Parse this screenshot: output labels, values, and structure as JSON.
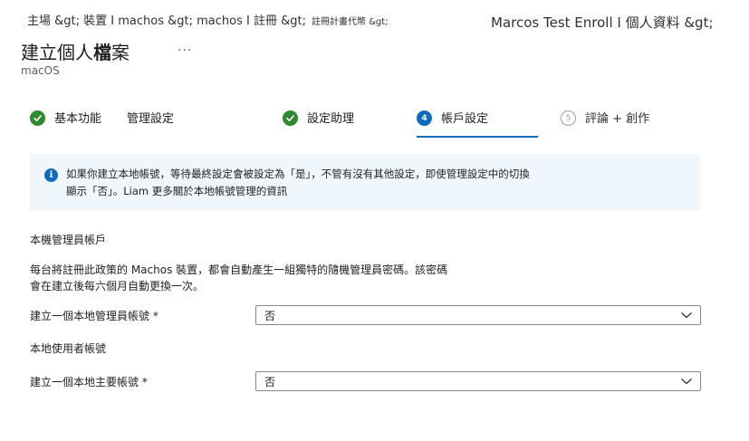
{
  "breadcrumb": {
    "left": "主場 &gt; 裝置 I machos &gt; machos I 註冊 &gt;",
    "small": "註冊計畫代幣 &gt;",
    "right": "Marcos Test Enroll I 個人資料 &gt;"
  },
  "page": {
    "title_a": "建立個人",
    "title_b": "檔",
    "title_c": "案",
    "more": "...",
    "subtitle": "macOS"
  },
  "steps": [
    {
      "number": "1",
      "label": "基本功能",
      "state": "done"
    },
    {
      "number": "2",
      "label": "管理設定",
      "state": "done"
    },
    {
      "number": "3",
      "label": "設定助理",
      "state": "done"
    },
    {
      "number": "4",
      "label": "帳戶設定",
      "state": "current"
    },
    {
      "number": "5",
      "label": "評論 + 創作",
      "state": "future"
    }
  ],
  "info": {
    "text": "如果你建立本地帳號，等待最終設定會被設定為「是」，不管有沒有其他設定，即使管理設定中的切換顯示「否」。Liam 更多關於本地帳號管理的資訊"
  },
  "admin_section": {
    "title": "本機管理員帳戶",
    "description": "每台將註冊此政策的 Machos 裝置，都會自動產生一組獨特的隨機管理員密碼。該密碼會在建立後每六個月自動更換一次。",
    "field_label": "建立一個本地管理員帳號 *",
    "field_value": "否"
  },
  "user_section": {
    "title": "本地使用者帳號",
    "field_label": "建立一個本地主要帳號 *",
    "field_value": "否"
  },
  "colors": {
    "done": "#2f8a2f",
    "accent": "#0f6cbd",
    "info_bg": "#eff6fc"
  }
}
